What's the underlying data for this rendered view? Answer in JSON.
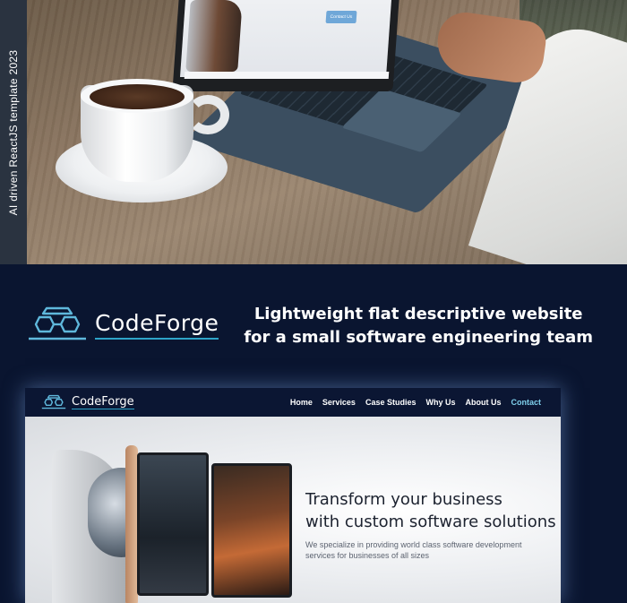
{
  "side_label": "AI driven ReactJS template 2023",
  "brand": {
    "name": "CodeForge",
    "tagline_line1": "Lightweight flat descriptive website",
    "tagline_line2": "for a small software engineering team"
  },
  "laptop_screen": {
    "button_label": "Contact Us"
  },
  "site": {
    "logo_text": "CodeForge",
    "nav": [
      {
        "label": "Home"
      },
      {
        "label": "Services"
      },
      {
        "label": "Case Studies"
      },
      {
        "label": "Why Us"
      },
      {
        "label": "About Us"
      },
      {
        "label": "Contact",
        "active": true
      }
    ],
    "hero": {
      "title_line1": "Transform your business",
      "title_line2": "with custom software solutions",
      "subtitle": "We specialize in providing world class software development services for businesses of all sizes"
    }
  },
  "colors": {
    "navy": "#0a1530",
    "accent": "#2da3c8",
    "nav_active": "#7fd0ec"
  }
}
